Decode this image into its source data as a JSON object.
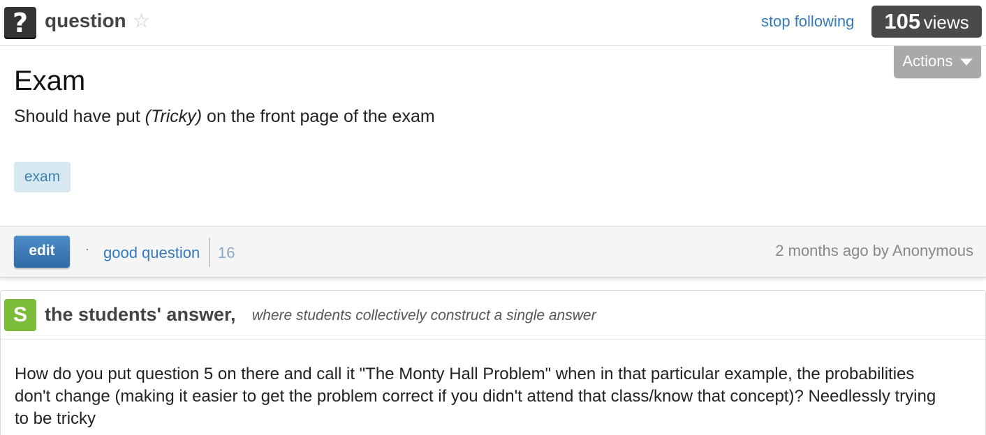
{
  "header": {
    "icon_glyph": "?",
    "label": "question",
    "star_glyph": "☆",
    "follow_link": "stop following",
    "views_count": "105",
    "views_label": "views"
  },
  "actions": {
    "label": "Actions"
  },
  "question": {
    "title": "Exam",
    "body_before": "Should have put ",
    "body_em": "(Tricky)",
    "body_after": " on the front page of the exam",
    "tags": [
      "exam"
    ]
  },
  "footer": {
    "edit_label": "edit",
    "dot": "·",
    "good_question_label": "good question",
    "good_question_count": "16",
    "meta": "2 months ago by Anonymous"
  },
  "students_answer": {
    "icon_letter": "S",
    "title": "the students' answer,",
    "subtitle": "where students collectively construct a single answer",
    "body": "How do you put question 5 on there and call it \"The Monty Hall Problem\" when in that particular example, the probabilities don't change (making it easier to get the problem correct if you didn't attend that class/know that concept)? Needlessly trying to be tricky"
  },
  "colors": {
    "link": "#3579b8",
    "edit_button": "#3a7bbf",
    "students_icon": "#7bbd3a",
    "tag_bg": "#d7e8f1",
    "views_badge": "#4a4a4a"
  }
}
